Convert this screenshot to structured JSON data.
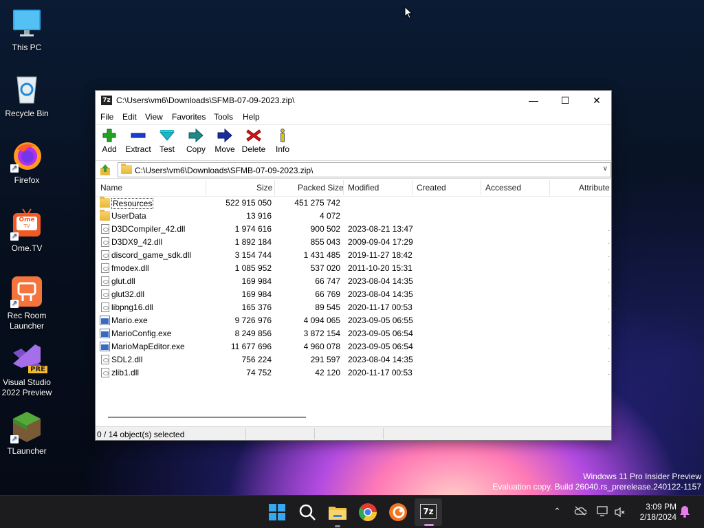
{
  "desktop": {
    "icons": [
      {
        "label": "This PC",
        "icon": "monitor-icon"
      },
      {
        "label": "Recycle Bin",
        "icon": "recycle-bin-icon"
      },
      {
        "label": "Firefox",
        "icon": "firefox-icon"
      },
      {
        "label": "Ome.TV",
        "icon": "ome-tv-icon",
        "badge": "Ome",
        "sub": "TV"
      },
      {
        "label": "Rec Room Launcher",
        "icon": "rec-room-icon"
      },
      {
        "label": "Visual Studio 2022 Preview",
        "icon": "visual-studio-icon",
        "badge": "PRE"
      },
      {
        "label": "TLauncher",
        "icon": "tlauncher-icon"
      }
    ]
  },
  "window": {
    "app_icon_text": "7z",
    "title": "C:\\Users\\vm6\\Downloads\\SFMB-07-09-2023.zip\\",
    "controls": {
      "minimize": "—",
      "maximize": "☐",
      "close": "✕"
    },
    "menu": [
      "File",
      "Edit",
      "View",
      "Favorites",
      "Tools",
      "Help"
    ],
    "toolbar": [
      {
        "label": "Add",
        "icon": "add-icon",
        "color": "#22a322"
      },
      {
        "label": "Extract",
        "icon": "extract-icon",
        "color": "#1a3ccf"
      },
      {
        "label": "Test",
        "icon": "test-icon",
        "color": "#1bb8c8"
      },
      {
        "label": "Copy",
        "icon": "copy-icon",
        "color": "#1e8a8a"
      },
      {
        "label": "Move",
        "icon": "move-icon",
        "color": "#1a2d9e"
      },
      {
        "label": "Delete",
        "icon": "delete-icon",
        "color": "#d01818"
      },
      {
        "label": "Info",
        "icon": "info-icon",
        "color": "#d8c400"
      }
    ],
    "address": "C:\\Users\\vm6\\Downloads\\SFMB-07-09-2023.zip\\",
    "columns": [
      "Name",
      "Size",
      "Packed Size",
      "Modified",
      "Created",
      "Accessed",
      "Attribute"
    ],
    "files": [
      {
        "name": "Resources",
        "type": "folder",
        "size": "522 915 050",
        "packed": "451 275 742",
        "modified": "",
        "selected": true
      },
      {
        "name": "UserData",
        "type": "folder",
        "size": "13 916",
        "packed": "4 072",
        "modified": ""
      },
      {
        "name": "D3DCompiler_42.dll",
        "type": "dll",
        "size": "1 974 616",
        "packed": "900 502",
        "modified": "2023-08-21 13:47"
      },
      {
        "name": "D3DX9_42.dll",
        "type": "dll",
        "size": "1 892 184",
        "packed": "855 043",
        "modified": "2009-09-04 17:29"
      },
      {
        "name": "discord_game_sdk.dll",
        "type": "dll",
        "size": "3 154 744",
        "packed": "1 431 485",
        "modified": "2019-11-27 18:42"
      },
      {
        "name": "fmodex.dll",
        "type": "dll",
        "size": "1 085 952",
        "packed": "537 020",
        "modified": "2011-10-20 15:31"
      },
      {
        "name": "glut.dll",
        "type": "dll",
        "size": "169 984",
        "packed": "66 747",
        "modified": "2023-08-04 14:35"
      },
      {
        "name": "glut32.dll",
        "type": "dll",
        "size": "169 984",
        "packed": "66 769",
        "modified": "2023-08-04 14:35"
      },
      {
        "name": "libpng16.dll",
        "type": "dll",
        "size": "165 376",
        "packed": "89 545",
        "modified": "2020-11-17 00:53"
      },
      {
        "name": "Mario.exe",
        "type": "exe",
        "size": "9 726 976",
        "packed": "4 094 065",
        "modified": "2023-09-05 06:55"
      },
      {
        "name": "MarioConfig.exe",
        "type": "exe",
        "size": "8 249 856",
        "packed": "3 872 154",
        "modified": "2023-09-05 06:54"
      },
      {
        "name": "MarioMapEditor.exe",
        "type": "exe",
        "size": "11 677 696",
        "packed": "4 960 078",
        "modified": "2023-09-05 06:54"
      },
      {
        "name": "SDL2.dll",
        "type": "dll",
        "size": "756 224",
        "packed": "291 597",
        "modified": "2023-08-04 14:35"
      },
      {
        "name": "zlib1.dll",
        "type": "dll",
        "size": "74 752",
        "packed": "42 120",
        "modified": "2020-11-17 00:53"
      }
    ],
    "status": "0 / 14 object(s) selected"
  },
  "watermark": {
    "line1": "Windows 11 Pro Insider Preview",
    "line2": "Evaluation copy. Build 26040.rs_prerelease.240122-1157"
  },
  "taskbar": {
    "apps": [
      "start-icon",
      "search-icon",
      "file-explorer-icon",
      "chrome-icon",
      "crunchyroll-icon",
      "7zip-icon"
    ],
    "seven_zip_label": "7z",
    "time": "3:09 PM",
    "date": "2/18/2024"
  }
}
